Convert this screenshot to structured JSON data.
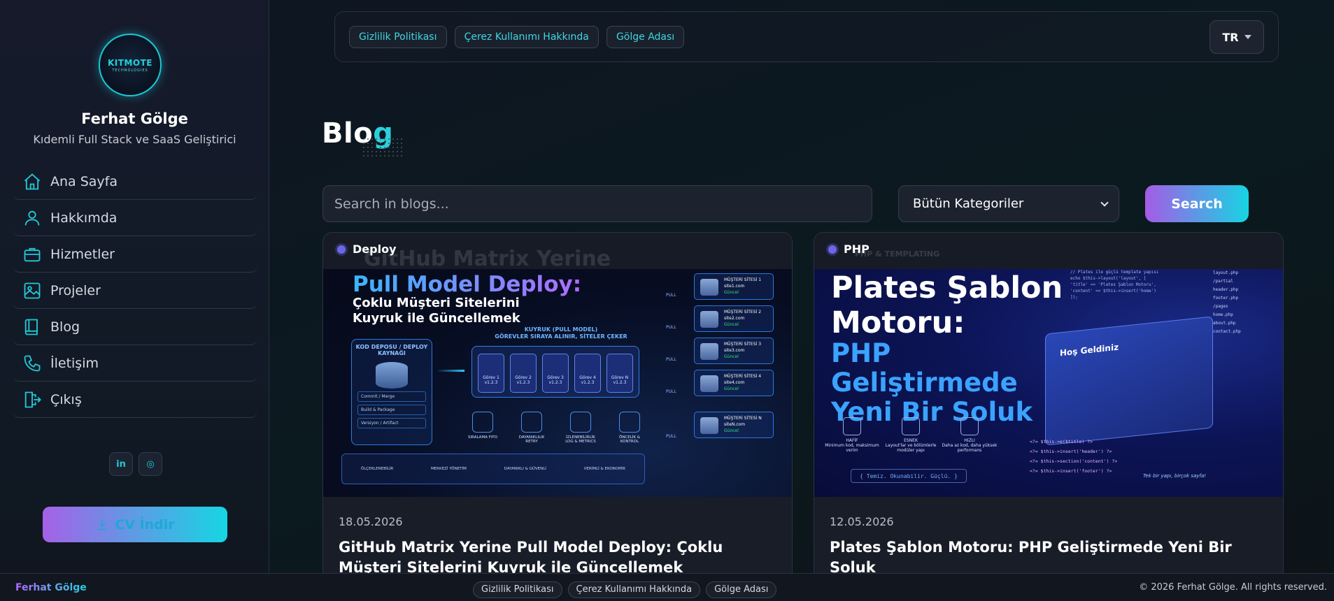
{
  "sidebar": {
    "logo": {
      "line1": "KITMOTE",
      "line2": "TECHNOLOGIES"
    },
    "user_name": "Ferhat Gölge",
    "user_role": "Kıdemli Full Stack ve SaaS Geliştirici",
    "nav": [
      {
        "label": "Ana Sayfa",
        "icon": "home-icon"
      },
      {
        "label": "Hakkımda",
        "icon": "user-icon"
      },
      {
        "label": "Hizmetler",
        "icon": "briefcase-icon"
      },
      {
        "label": "Projeler",
        "icon": "image-icon"
      },
      {
        "label": "Blog",
        "icon": "book-icon"
      },
      {
        "label": "İletişim",
        "icon": "phone-icon"
      },
      {
        "label": "Çıkış",
        "icon": "logout-icon"
      }
    ],
    "socials": [
      {
        "label": "in",
        "icon": "linkedin-icon"
      },
      {
        "label": "◎",
        "icon": "instagram-icon"
      }
    ],
    "cv_button": "CV İndir"
  },
  "topbar": {
    "links": [
      "Gizlilik Politikası",
      "Çerez Kullanımı Hakkında",
      "Gölge Adası"
    ],
    "language": "TR"
  },
  "page": {
    "title_main": "Blo",
    "title_accent": "g"
  },
  "filters": {
    "search_placeholder": "Search in blogs...",
    "category_selected": "Bütün Kategoriler",
    "search_button": "Search"
  },
  "posts": [
    {
      "category": "Deploy",
      "ghost_title": "GitHub Matrix Yerine",
      "date": "18.05.2026",
      "title": "GitHub Matrix Yerine Pull Model Deploy: Çoklu Müşteri Sitelerini Kuyruk ile Güncellemek",
      "image": {
        "headline": "Pull Model Deploy:",
        "subheadline": "Çoklu Müşteri Sitelerini Kuyruk ile Güncellemek",
        "source_title": "KOD DEPOSU / DEPLOY KAYNAĞI",
        "source_items": [
          "Commit / Merge",
          "Build & Package",
          "Versiyon / Artifact"
        ],
        "queue_title": "KUYRUK (PULL MODEL)",
        "queue_sub": "GÖREVLER SIRAYA ALINIR, SİTELER ÇEKER",
        "jobs": [
          "Görev 1 v1.2.3",
          "Görev 2 v1.2.3",
          "Görev 3 v1.2.3",
          "Görev 4 v1.2.3",
          "Görev N v1.2.3"
        ],
        "targets": [
          {
            "name": "MÜŞTERİ SİTESİ 1",
            "url": "site1.com",
            "status": "Güncel"
          },
          {
            "name": "MÜŞTERİ SİTESİ 2",
            "url": "site2.com",
            "status": "Güncel"
          },
          {
            "name": "MÜŞTERİ SİTESİ 3",
            "url": "site3.com",
            "status": "Güncel"
          },
          {
            "name": "MÜŞTERİ SİTESİ 4",
            "url": "site4.com",
            "status": "Güncel"
          },
          {
            "name": "MÜŞTERİ SİTESİ N",
            "url": "siteN.com",
            "status": "Güncel"
          }
        ],
        "pull_label": "PULL",
        "features": [
          "SIRALAMA FIFO",
          "DAYANIKLILIK RETRY",
          "İZLENEBİLİRLİK LOG & METRICS",
          "ÖNCELİK & KONTROL"
        ],
        "bottom": [
          "ÖLÇEKLENEBİLİR",
          "MERKEZİ YÖNETİM",
          "DAYANIKLI & GÜVENLİ",
          "VERİMLİ & EKONOMİK"
        ]
      }
    },
    {
      "category": "PHP",
      "ghost_title": "PHP & TEMPLATING",
      "date": "12.05.2026",
      "title": "Plates Şablon Motoru: PHP Geliştirmede Yeni Bir Soluk",
      "image": {
        "headline": "Plates Şablon Motoru:",
        "subheadline": "PHP Geliştirmede Yeni Bir Soluk",
        "code": [
          "// Plates ile güçlü template yapısı",
          "echo $this->layout('layout', [",
          "  'title' => 'Plates Şablon Motoru',",
          "  'content' => $this->insert('home')",
          "]);"
        ],
        "tree": [
          "layout.php",
          "/partial",
          "header.php",
          "footer.php",
          "/pages",
          "home.php",
          "about.php",
          "contact.php"
        ],
        "mock_title": "Hoş Geldiniz",
        "features": [
          {
            "name": "HAFİF",
            "desc": "Minimum kod, maksimum verim"
          },
          {
            "name": "ESNEK",
            "desc": "Layout'lar ve bölümlerle modüler yapı"
          },
          {
            "name": "HIZLI",
            "desc": "Daha az kod, daha yüksek performans"
          }
        ],
        "motto": "{ Temiz. Okunabilir. Güçlü. }",
        "snippet": [
          "<?= $this->e($title) ?>",
          "<?= $this->insert('header') ?>",
          "<?= $this->section('content') ?>",
          "<?= $this->insert('footer') ?>"
        ],
        "tagline": "Tek bir yapı, birçok sayfa!"
      }
    }
  ],
  "footer": {
    "brand": "Ferhat Gölge",
    "links": [
      "Gizlilik Politikası",
      "Çerez Kullanımı Hakkında",
      "Gölge Adası"
    ],
    "copyright": "© 2026 Ferhat Gölge. All rights reserved."
  },
  "colors": {
    "accent_cyan": "#22c8d6",
    "accent_purple": "#a561e6",
    "background": "#0f1522"
  }
}
